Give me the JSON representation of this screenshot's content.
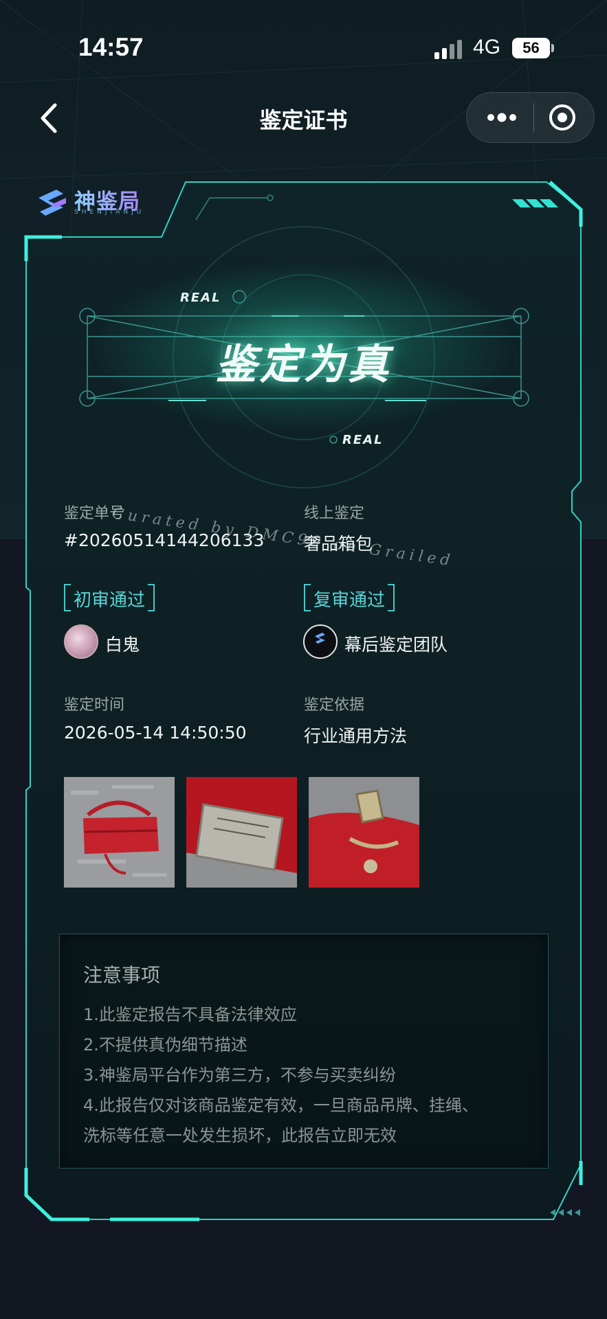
{
  "status_bar": {
    "time": "14:57",
    "network": "4G",
    "battery": "56"
  },
  "nav": {
    "title": "鉴定证书"
  },
  "logo": {
    "name": "神鉴局",
    "subtitle": "SHENJIANJU"
  },
  "result": {
    "verdict": "鉴定为真",
    "tag_top": "REAL",
    "tag_bottom": "REAL"
  },
  "watermark": "Curated by DMC99 on Grailed",
  "fields": {
    "order_label": "鉴定单号",
    "order_value": "#20260514144206133",
    "method_label": "线上鉴定",
    "category_value": "奢品箱包",
    "first_review": "初审通过",
    "first_reviewer": "白鬼",
    "second_review": "复审通过",
    "second_reviewer": "幕后鉴定团队",
    "time_label": "鉴定时间",
    "time_value": "2026-05-14 14:50:50",
    "basis_label": "鉴定依据",
    "basis_value": "行业通用方法"
  },
  "photos": [
    {
      "name": "red-handbag-photo"
    },
    {
      "name": "logo-plate-photo"
    },
    {
      "name": "buckle-detail-photo"
    }
  ],
  "notice": {
    "title": "注意事项",
    "items": [
      "1.此鉴定报告不具备法律效应",
      "2.不提供真伪细节描述",
      "3.神鉴局平台作为第三方，不参与买卖纠纷",
      "4.此报告仅对该商品鉴定有效，一旦商品吊牌、挂绳、",
      "洗标等任意一处发生损坏，此报告立即无效"
    ]
  },
  "colors": {
    "accent": "#3fe0d0",
    "background": "#121721",
    "card": "#0f2226"
  }
}
